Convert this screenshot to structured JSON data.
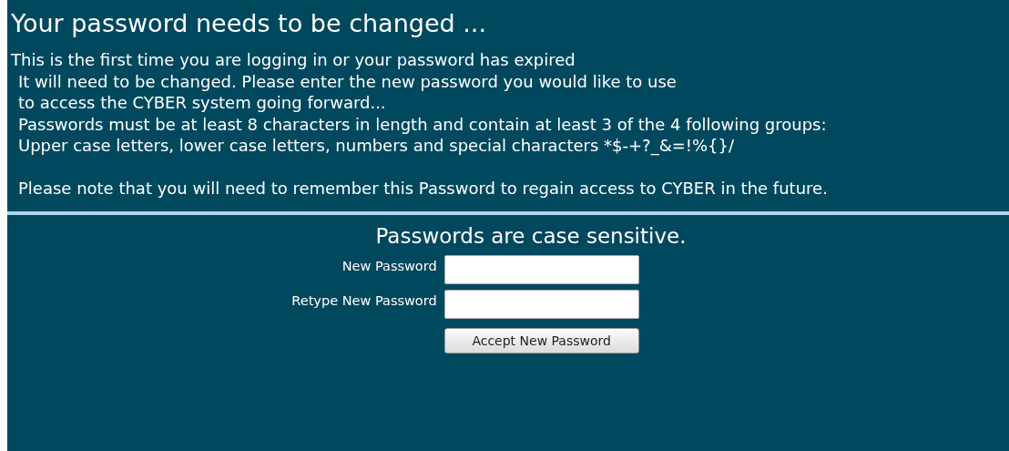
{
  "title": "Your password needs to be changed ...",
  "message_lines": [
    "This is the first time you are logging in or your password has expired",
    "It will need to be changed. Please enter the new password you would like to use",
    "to access the CYBER system going forward...",
    "Passwords must be at least 8 characters in length and contain at least 3 of the 4 following groups:",
    "Upper case letters, lower case letters, numbers and special characters *$-+?_&=!%{}/"
  ],
  "note": "Please note that you will need to remember this Password to regain access to CYBER in the future.",
  "form": {
    "heading": "Passwords are case sensitive.",
    "fields": [
      {
        "label": "New Password"
      },
      {
        "label": "Retype New Password"
      }
    ],
    "button": "Accept New Password"
  }
}
